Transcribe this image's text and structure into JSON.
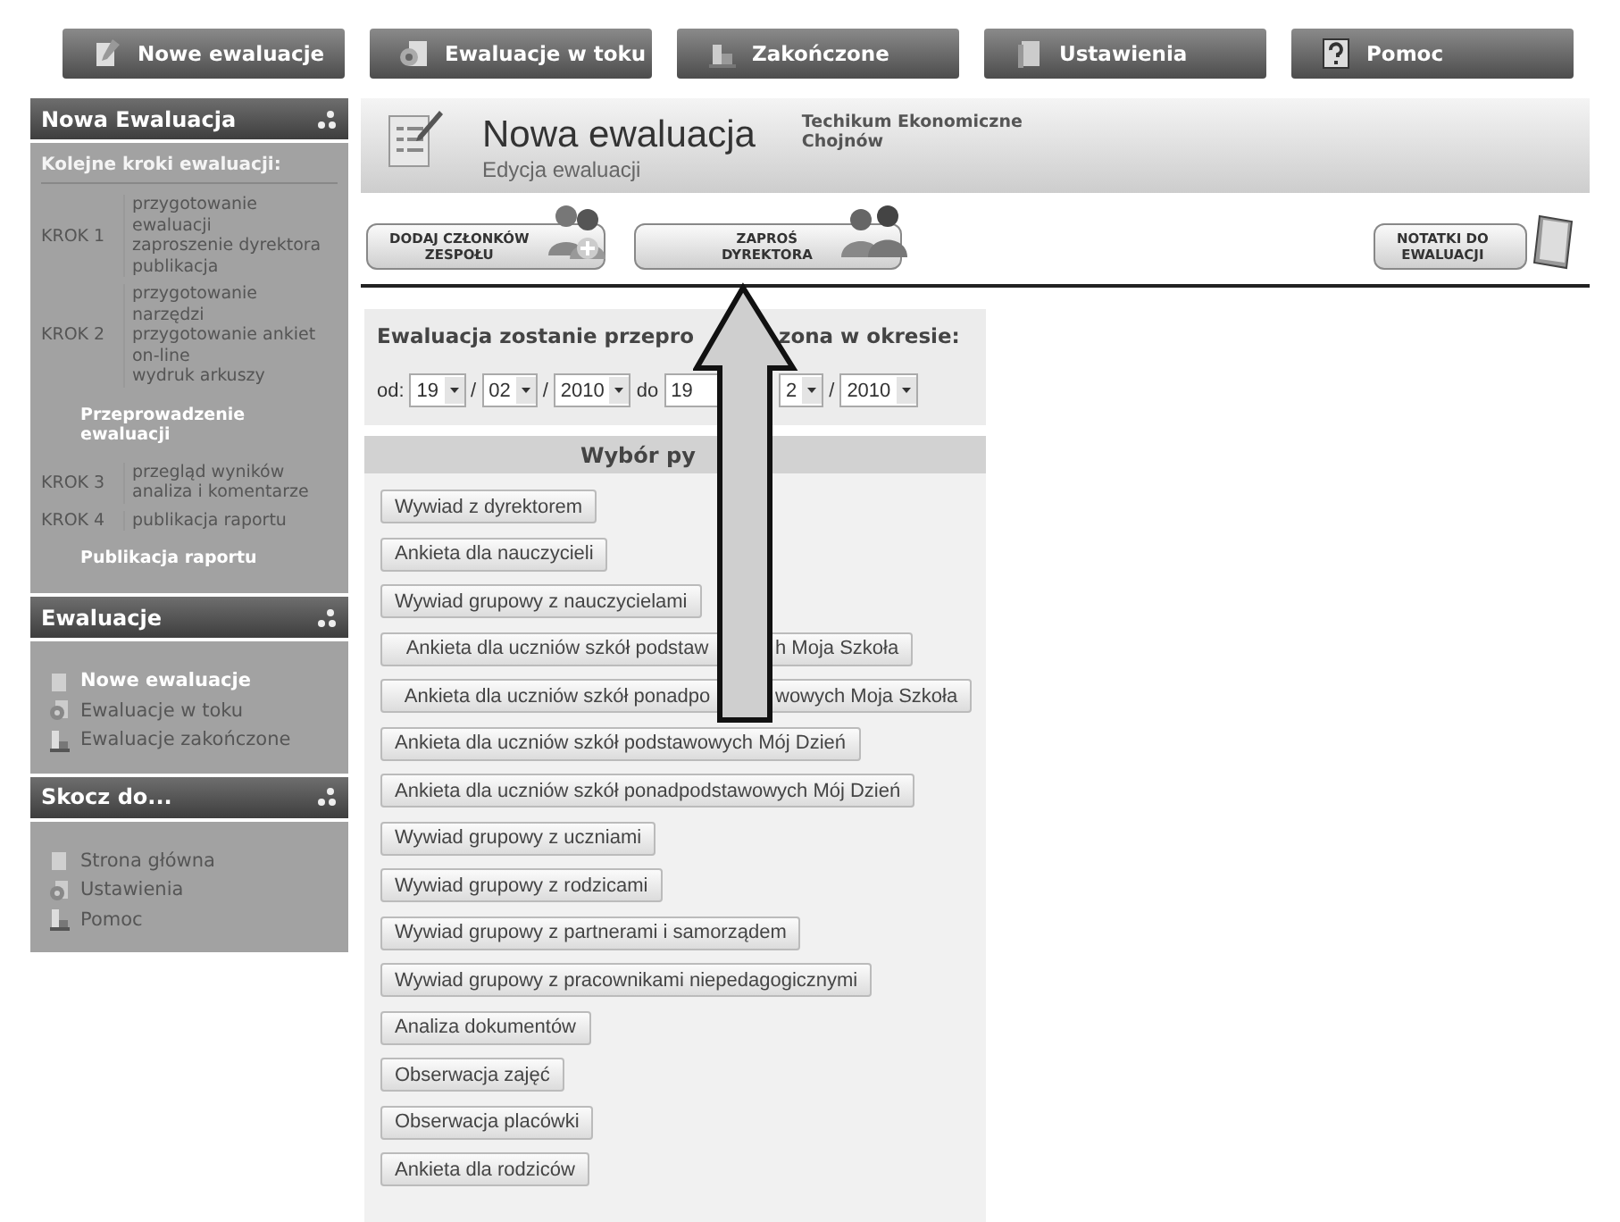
{
  "nav_tabs": [
    {
      "label": "Nowe ewaluacje",
      "kind": "new"
    },
    {
      "label": "Ewaluacje w toku",
      "kind": "progress"
    },
    {
      "label": "Zakończone",
      "kind": "done"
    },
    {
      "label": "Ustawienia",
      "kind": "settings"
    },
    {
      "label": "Pomoc",
      "kind": "help"
    }
  ],
  "sidebar": {
    "sections": [
      {
        "title": "Nowa Ewaluacja",
        "subtitle": "Kolejne kroki ewaluacji:",
        "kind": "steps",
        "items": [
          {
            "kind": "step",
            "label": "KROK 1",
            "lines": [
              "przygotowanie",
              "ewaluacji",
              "zaproszenie dyrektora",
              "publikacja"
            ]
          },
          {
            "kind": "step",
            "label": "KROK 2",
            "lines": [
              "przygotowanie",
              "narzędzi",
              "przygotowanie ankiet",
              "on-line",
              "wydruk arkuszy"
            ]
          },
          {
            "kind": "stage",
            "label": "Przeprowadzenie ewaluacji"
          },
          {
            "kind": "step",
            "label": "KROK 3",
            "lines": [
              "przegląd wyników",
              "analiza i komentarze"
            ]
          },
          {
            "kind": "step",
            "label": "KROK 4",
            "lines": [
              "publikacja raportu"
            ]
          },
          {
            "kind": "stage",
            "label": "Publikacja raportu"
          }
        ]
      },
      {
        "title": "Ewaluacje",
        "kind": "links",
        "items": [
          {
            "label": "Nowe ewaluacje",
            "kind": "new",
            "selected": true
          },
          {
            "label": "Ewaluacje w toku",
            "kind": "progress",
            "selected": false
          },
          {
            "label": "Ewaluacje zakończone",
            "kind": "done",
            "selected": false
          }
        ]
      },
      {
        "title": "Skocz do...",
        "kind": "links",
        "items": [
          {
            "label": "Strona główna",
            "kind": "new",
            "selected": false
          },
          {
            "label": "Ustawienia",
            "kind": "progress",
            "selected": false
          },
          {
            "label": "Pomoc",
            "kind": "done",
            "selected": false
          }
        ]
      }
    ]
  },
  "header": {
    "title": "Nowa ewaluacja",
    "subtitle": "Edycja ewaluacji",
    "school": [
      "Techikum Ekonomiczne",
      "Chojnów"
    ]
  },
  "actions": [
    {
      "kind": "team",
      "lines": [
        "DODAJ CZŁONKÓW",
        "ZESPOŁU"
      ]
    },
    {
      "kind": "invite",
      "lines": [
        "ZAPROŚ",
        "DYREKTORA"
      ]
    },
    {
      "kind": "notes",
      "lines": [
        "NOTATKI DO",
        "EWALUACJI"
      ]
    }
  ],
  "period": {
    "heading": [
      "Ewaluacja zostanie przepro",
      "zona w okresie:"
    ],
    "from_label": "od:",
    "from": {
      "day": "19",
      "sep1": "/",
      "month": "02",
      "sep2": "/",
      "year": "2010"
    },
    "to_label": "do",
    "to": {
      "day": "19",
      "month": "2",
      "sep2": "/",
      "year": "2010"
    }
  },
  "questions": {
    "header": "Wybór py",
    "items": [
      {
        "parts": [
          "Wywiad z dyrektorem"
        ]
      },
      {
        "parts": [
          "Ankieta dla nauczycieli"
        ]
      },
      {
        "parts": [
          "Wywiad grupowy z nauczycielami"
        ]
      },
      {
        "parts": [
          "Ankieta dla uczniów szkół podstaw",
          "h Moja Szkoła"
        ]
      },
      {
        "parts": [
          "Ankieta dla uczniów szkół ponadpo",
          "wowych Moja Szkoła"
        ]
      },
      {
        "parts": [
          "Ankieta dla uczniów szkół podstawowych Mój Dzień"
        ]
      },
      {
        "parts": [
          "Ankieta dla uczniów szkół ponadpodstawowych Mój Dzień"
        ]
      },
      {
        "parts": [
          "Wywiad grupowy z uczniami"
        ]
      },
      {
        "parts": [
          "Wywiad grupowy z rodzicami"
        ]
      },
      {
        "parts": [
          "Wywiad grupowy z partnerami i samorządem"
        ]
      },
      {
        "parts": [
          "Wywiad grupowy z pracownikami niepedagogicznymi"
        ]
      },
      {
        "parts": [
          "Analiza dokumentów"
        ]
      },
      {
        "parts": [
          "Obserwacja zajęć"
        ]
      },
      {
        "parts": [
          "Obserwacja placówki"
        ]
      },
      {
        "parts": [
          "Ankieta dla rodziców"
        ]
      }
    ]
  }
}
